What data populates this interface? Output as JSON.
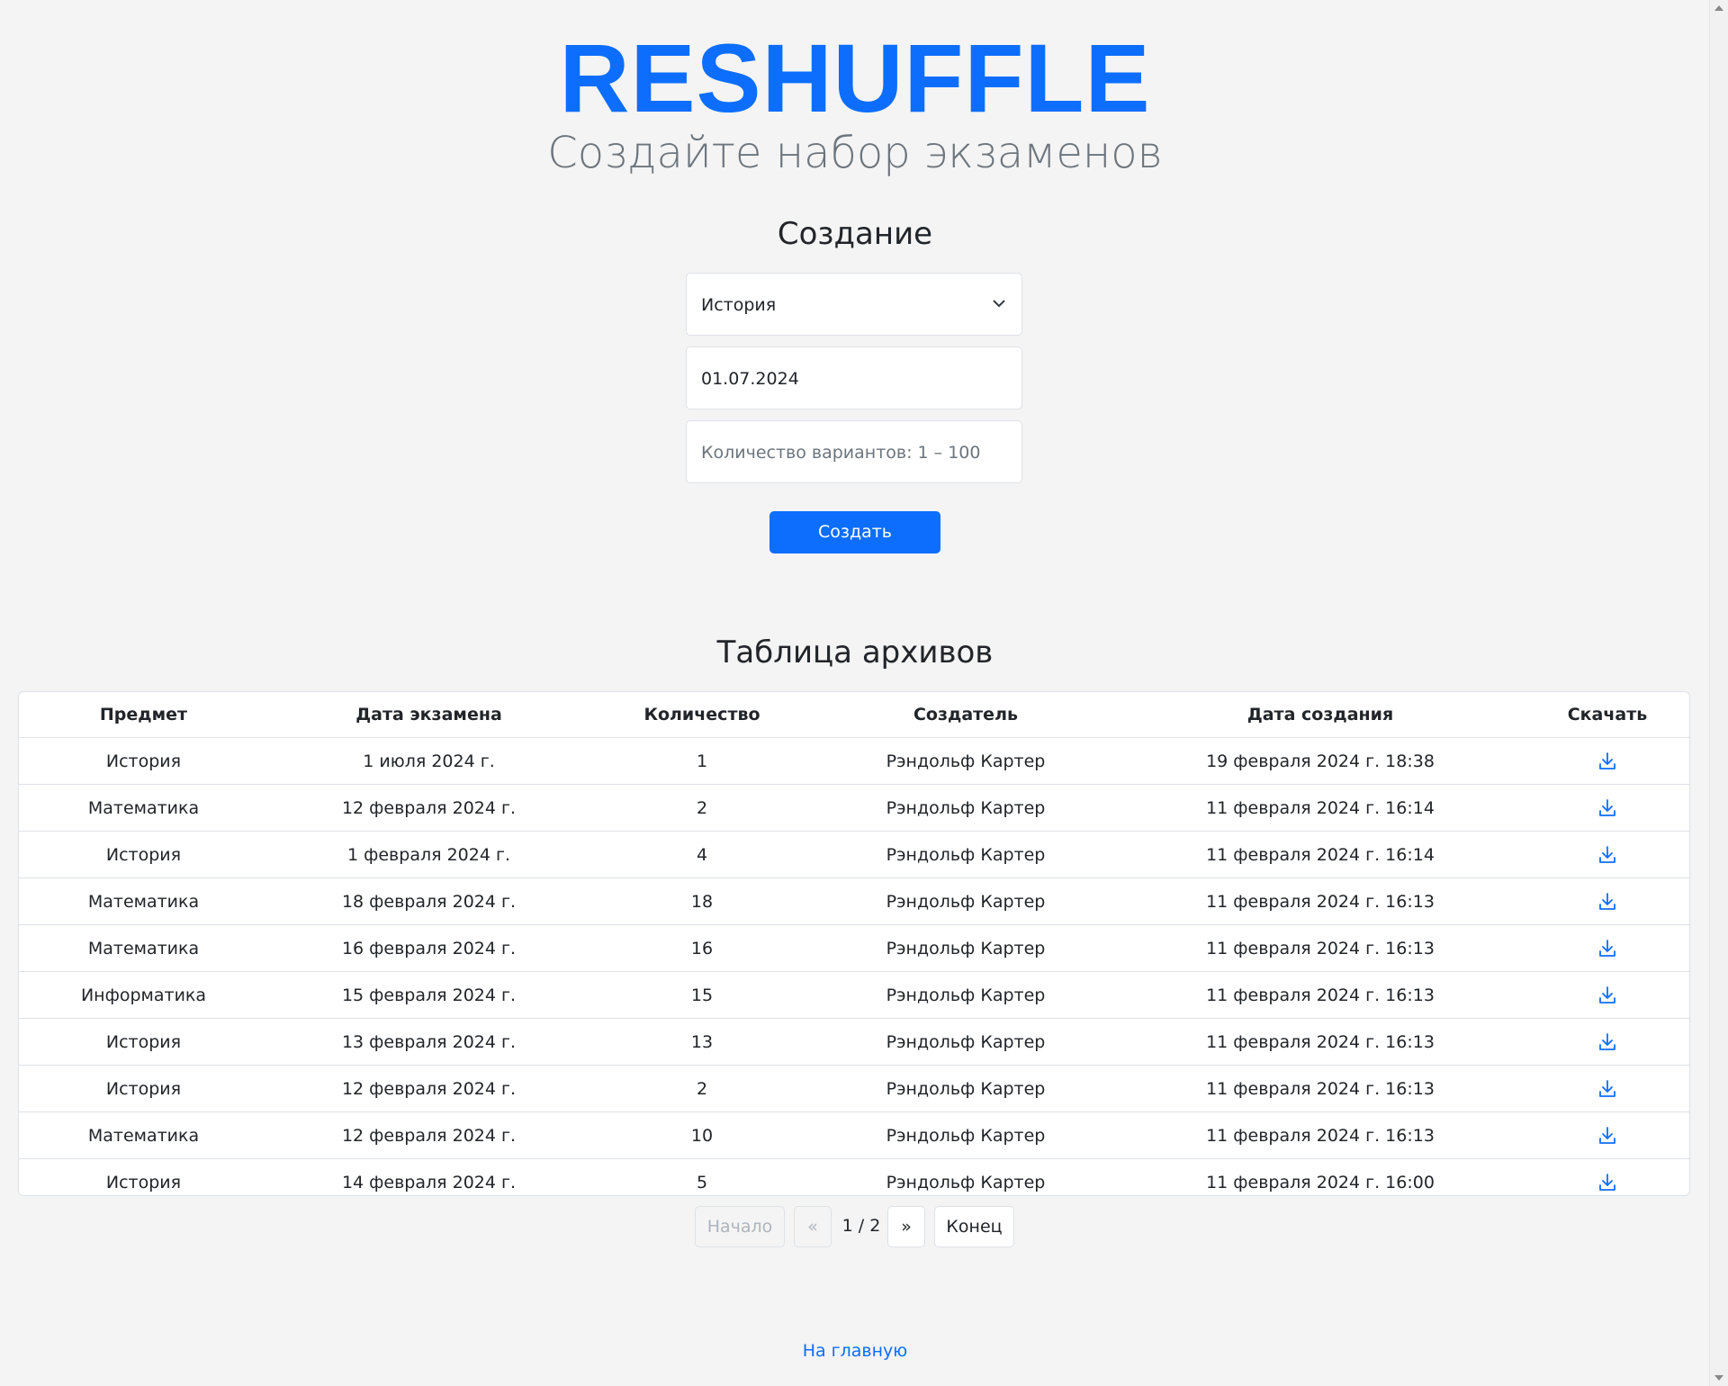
{
  "header": {
    "brand": "RESHUFFLE",
    "subtitle": "Создайте набор экзаменов"
  },
  "create": {
    "title": "Создание",
    "subject_selected": "История",
    "date_value": "01.07.2024",
    "count_placeholder": "Количество вариантов: 1 – 100",
    "submit_label": "Создать"
  },
  "archive": {
    "title": "Таблица архивов",
    "columns": [
      "Предмет",
      "Дата экзамена",
      "Количество",
      "Создатель",
      "Дата создания",
      "Скачать"
    ],
    "rows": [
      [
        "История",
        "1 июля 2024 г.",
        "1",
        "Рэндольф Картер",
        "19 февраля 2024 г. 18:38"
      ],
      [
        "Математика",
        "12 февраля 2024 г.",
        "2",
        "Рэндольф Картер",
        "11 февраля 2024 г. 16:14"
      ],
      [
        "История",
        "1 февраля 2024 г.",
        "4",
        "Рэндольф Картер",
        "11 февраля 2024 г. 16:14"
      ],
      [
        "Математика",
        "18 февраля 2024 г.",
        "18",
        "Рэндольф Картер",
        "11 февраля 2024 г. 16:13"
      ],
      [
        "Математика",
        "16 февраля 2024 г.",
        "16",
        "Рэндольф Картер",
        "11 февраля 2024 г. 16:13"
      ],
      [
        "Информатика",
        "15 февраля 2024 г.",
        "15",
        "Рэндольф Картер",
        "11 февраля 2024 г. 16:13"
      ],
      [
        "История",
        "13 февраля 2024 г.",
        "13",
        "Рэндольф Картер",
        "11 февраля 2024 г. 16:13"
      ],
      [
        "История",
        "12 февраля 2024 г.",
        "2",
        "Рэндольф Картер",
        "11 февраля 2024 г. 16:13"
      ],
      [
        "Математика",
        "12 февраля 2024 г.",
        "10",
        "Рэндольф Картер",
        "11 февраля 2024 г. 16:13"
      ],
      [
        "История",
        "14 февраля 2024 г.",
        "5",
        "Рэндольф Картер",
        "11 февраля 2024 г. 16:00"
      ]
    ],
    "download_icon": "download-icon"
  },
  "pagination": {
    "first_label": "Начало",
    "prev_label": "«",
    "page_info": "1 / 2",
    "next_label": "»",
    "last_label": "Конец"
  },
  "footer": {
    "home_link": "На главную"
  },
  "colors": {
    "accent": "#0d6efd",
    "background": "#f4f4f4",
    "muted": "#6c757d"
  }
}
